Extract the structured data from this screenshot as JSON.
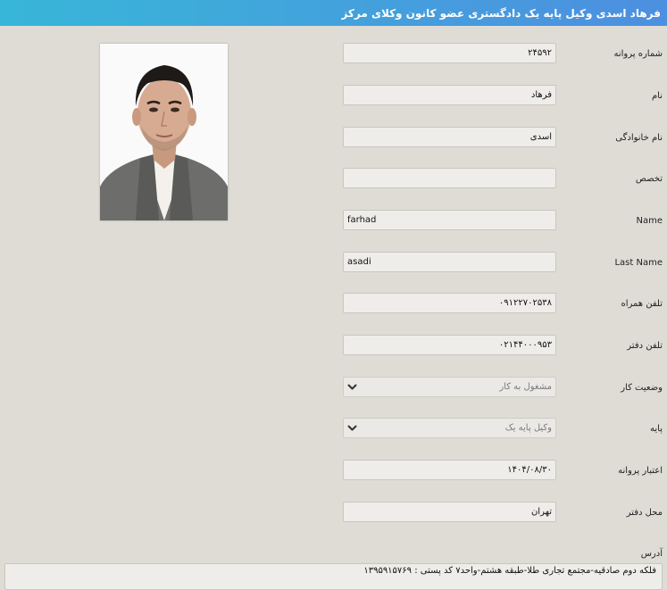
{
  "header": {
    "title": "فرهاد اسدی وکیل پایه یک دادگستری عضو کانون وکلای مرکز"
  },
  "photo": {
    "alt": "profile-photo"
  },
  "fields": {
    "license_number": {
      "label": "شماره پروانه",
      "value": "۲۴۵۹۲"
    },
    "first_name": {
      "label": "نام",
      "value": "فرهاد"
    },
    "last_name": {
      "label": "نام خانوادگی",
      "value": "اسدی"
    },
    "specialty": {
      "label": "تخصص",
      "value": ""
    },
    "name_en": {
      "label": "Name",
      "value": "farhad"
    },
    "last_name_en": {
      "label": "Last Name",
      "value": "asadi"
    },
    "mobile": {
      "label": "تلفن همراه",
      "value": "۰۹۱۲۲۷۰۲۵۳۸"
    },
    "office_phone": {
      "label": "تلفن دفتر",
      "value": "۰۲۱۴۴۰۰۰۹۵۳"
    },
    "work_status": {
      "label": "وضعیت کار",
      "value": "مشغول به کار"
    },
    "grade": {
      "label": "پایه",
      "value": "وکیل پایه یک"
    },
    "license_validity": {
      "label": "اعتبار پروانه",
      "value": "۱۴۰۴/۰۸/۳۰"
    },
    "office_location": {
      "label": "محل دفتر",
      "value": "تهران"
    },
    "address": {
      "label": "آدرس",
      "value": "فلکه دوم صادقیه-مجتمع تجاری طلا-طبقه هشتم-واحد۷ کد پستی : ۱۳۹۵۹۱۵۷۶۹"
    }
  },
  "colors": {
    "header_start": "#38b6d8",
    "header_end": "#4d8fe0",
    "background": "#dfdcd6",
    "field_bg": "#efede9"
  },
  "icons": {
    "select_arrow": "chevron-down-icon"
  }
}
